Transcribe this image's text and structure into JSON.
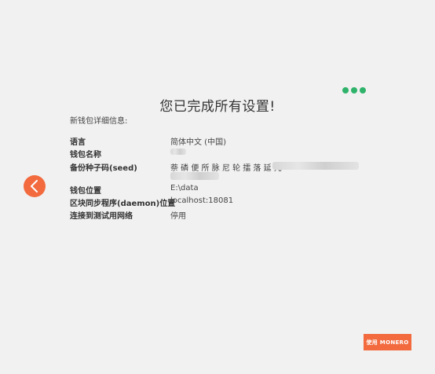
{
  "header": {
    "title": "您已完成所有设置!",
    "subtitle": "新钱包详细信息:"
  },
  "progress": {
    "dot_count": 3,
    "color": "#2fb36a"
  },
  "details": {
    "language_label": "语言",
    "language_value": "简体中文 (中国)",
    "wallet_name_label": "钱包名称",
    "seed_label": "备份种子码(seed)",
    "seed_value_visible": "萘 磷 便 所 脉 尼 轮 擂 落 延 托",
    "wallet_location_label": "钱包位置",
    "wallet_location_value": "E:\\data",
    "daemon_label": "区块同步程序(daemon)位置",
    "daemon_value": "localhost:18081",
    "testnet_label": "连接到测试用网络",
    "testnet_value": "停用"
  },
  "buttons": {
    "use_monero_label": "使用 MONERO",
    "back_icon": "chevron-left-icon"
  },
  "colors": {
    "accent": "#f26a3d",
    "background": "#f1f1f1"
  }
}
